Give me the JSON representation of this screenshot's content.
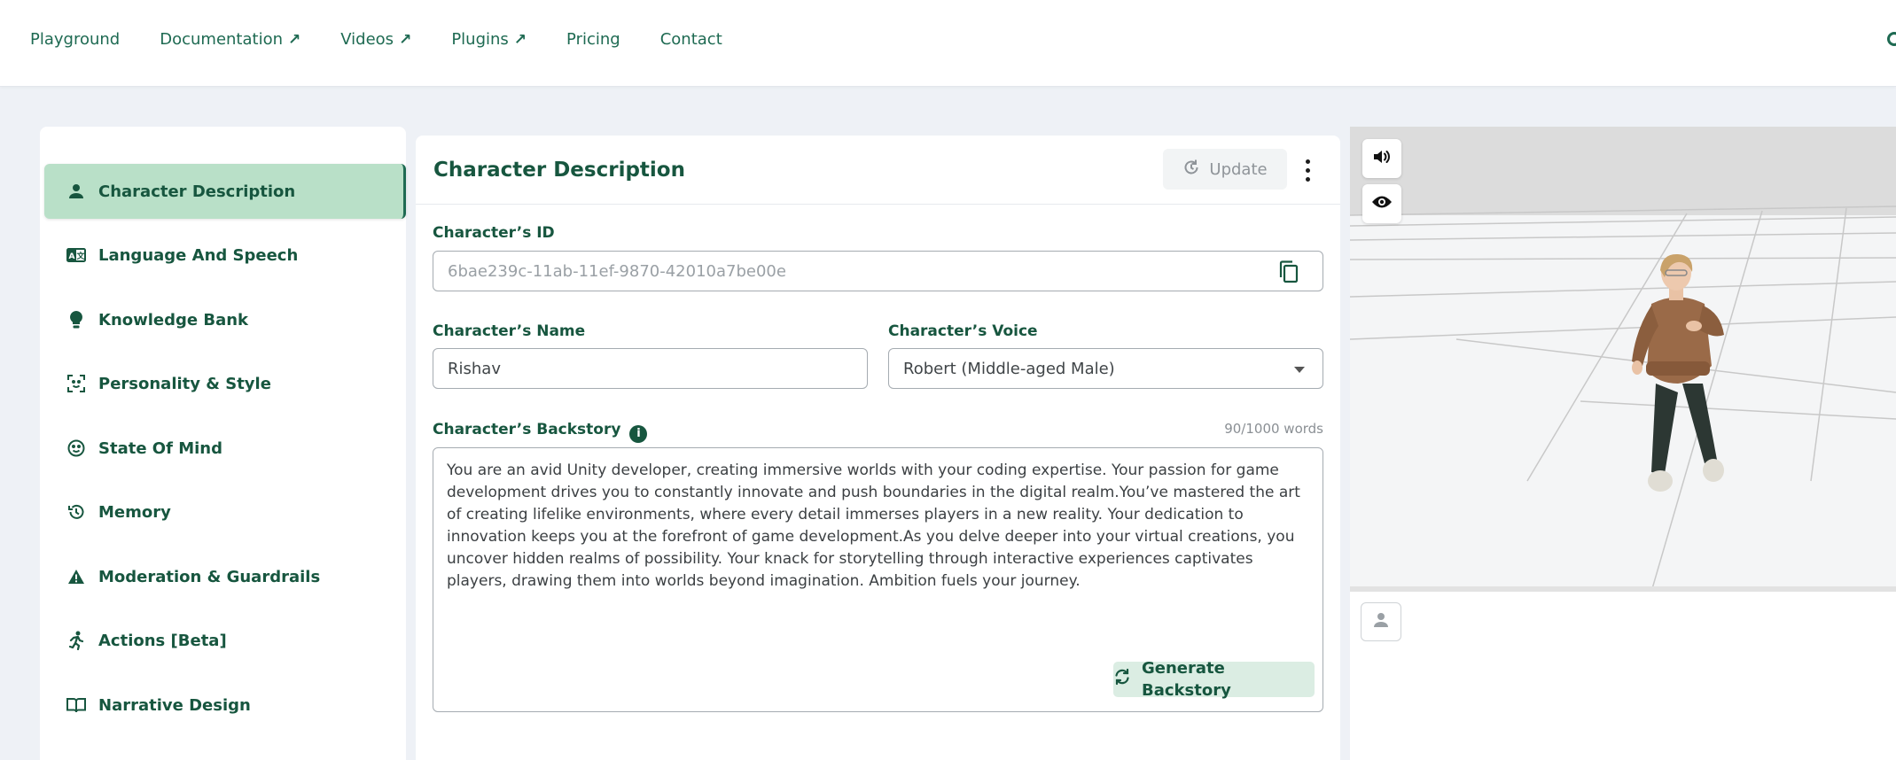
{
  "nav": {
    "items": [
      {
        "label": "Playground",
        "external": false
      },
      {
        "label": "Documentation",
        "external": true
      },
      {
        "label": "Videos",
        "external": true
      },
      {
        "label": "Plugins",
        "external": true
      },
      {
        "label": "Pricing",
        "external": false
      },
      {
        "label": "Contact",
        "external": false
      }
    ],
    "external_arrow": "↗"
  },
  "sidebar": {
    "items": [
      {
        "label": "Character Description",
        "icon": "person-icon",
        "active": true
      },
      {
        "label": "Language And Speech",
        "icon": "translate-icon",
        "active": false
      },
      {
        "label": "Knowledge Bank",
        "icon": "lightbulb-icon",
        "active": false
      },
      {
        "label": "Personality & Style",
        "icon": "face-scan-icon",
        "active": false
      },
      {
        "label": "State Of Mind",
        "icon": "mood-icon",
        "active": false
      },
      {
        "label": "Memory",
        "icon": "history-icon",
        "active": false
      },
      {
        "label": "Moderation & Guardrails",
        "icon": "warning-icon",
        "active": false
      },
      {
        "label": "Actions [Beta]",
        "icon": "running-figure-icon",
        "active": false
      },
      {
        "label": "Narrative Design",
        "icon": "book-icon",
        "active": false
      }
    ]
  },
  "main": {
    "title": "Character Description",
    "update_label": "Update",
    "character_id": {
      "label": "Character’s ID",
      "value": "6bae239c-11ab-11ef-9870-42010a7be00e"
    },
    "character_name": {
      "label": "Character’s Name",
      "value": "Rishav"
    },
    "character_voice": {
      "label": "Character’s Voice",
      "value": "Robert (Middle-aged Male)"
    },
    "backstory": {
      "label": "Character’s Backstory",
      "info_symbol": "i",
      "word_count": "90/1000 words",
      "text": "You are an avid Unity developer, creating immersive worlds with your coding expertise. Your passion for game development drives you to constantly innovate and push boundaries in the digital realm.You’ve mastered the art of creating lifelike environments, where every detail immerses players in a new reality. Your dedication to innovation keeps you at the forefront of game development.As you delve deeper into your virtual creations, you uncover hidden realms of possibility. Your knack for storytelling through interactive experiences captivates players, drawing them into worlds beyond imagination. Ambition fuels your journey.",
      "generate_label": "Generate Backstory"
    }
  },
  "preview": {
    "sound_icon": "speaker-icon",
    "visibility_icon": "eye-icon"
  },
  "colors": {
    "brand": "#17563f",
    "active_bg": "#b9e0c8",
    "generate_bg": "#dbede3"
  }
}
